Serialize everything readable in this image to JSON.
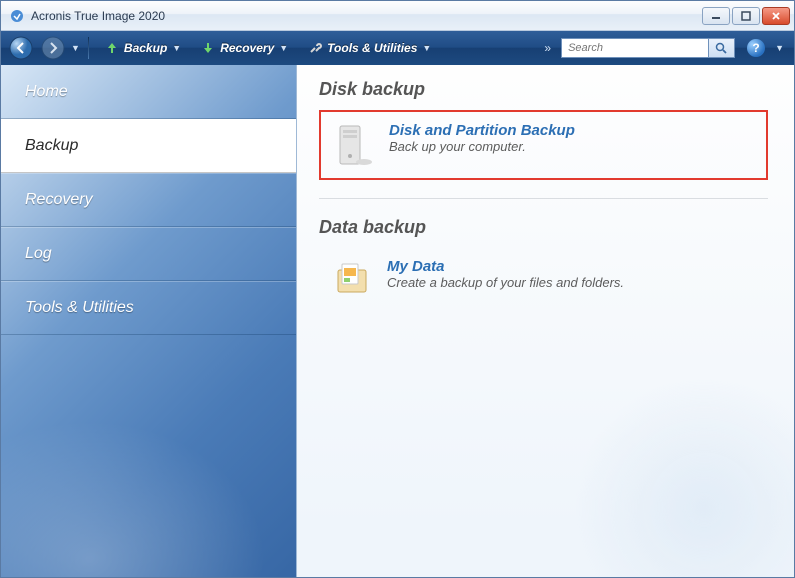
{
  "window": {
    "title": "Acronis True Image 2020"
  },
  "toolbar": {
    "backup_label": "Backup",
    "recovery_label": "Recovery",
    "tools_label": "Tools & Utilities"
  },
  "search": {
    "placeholder": "Search"
  },
  "sidebar": {
    "items": [
      {
        "label": "Home"
      },
      {
        "label": "Backup"
      },
      {
        "label": "Recovery"
      },
      {
        "label": "Log"
      },
      {
        "label": "Tools & Utilities"
      }
    ],
    "active_index": 1
  },
  "main": {
    "sections": [
      {
        "title": "Disk backup",
        "items": [
          {
            "title": "Disk and Partition Backup",
            "desc": "Back up your computer.",
            "highlighted": true
          }
        ]
      },
      {
        "title": "Data backup",
        "items": [
          {
            "title": "My Data",
            "desc": "Create a backup of your files and folders."
          }
        ]
      }
    ]
  },
  "colors": {
    "highlight": "#e23a2e",
    "link": "#2c6fb4"
  }
}
